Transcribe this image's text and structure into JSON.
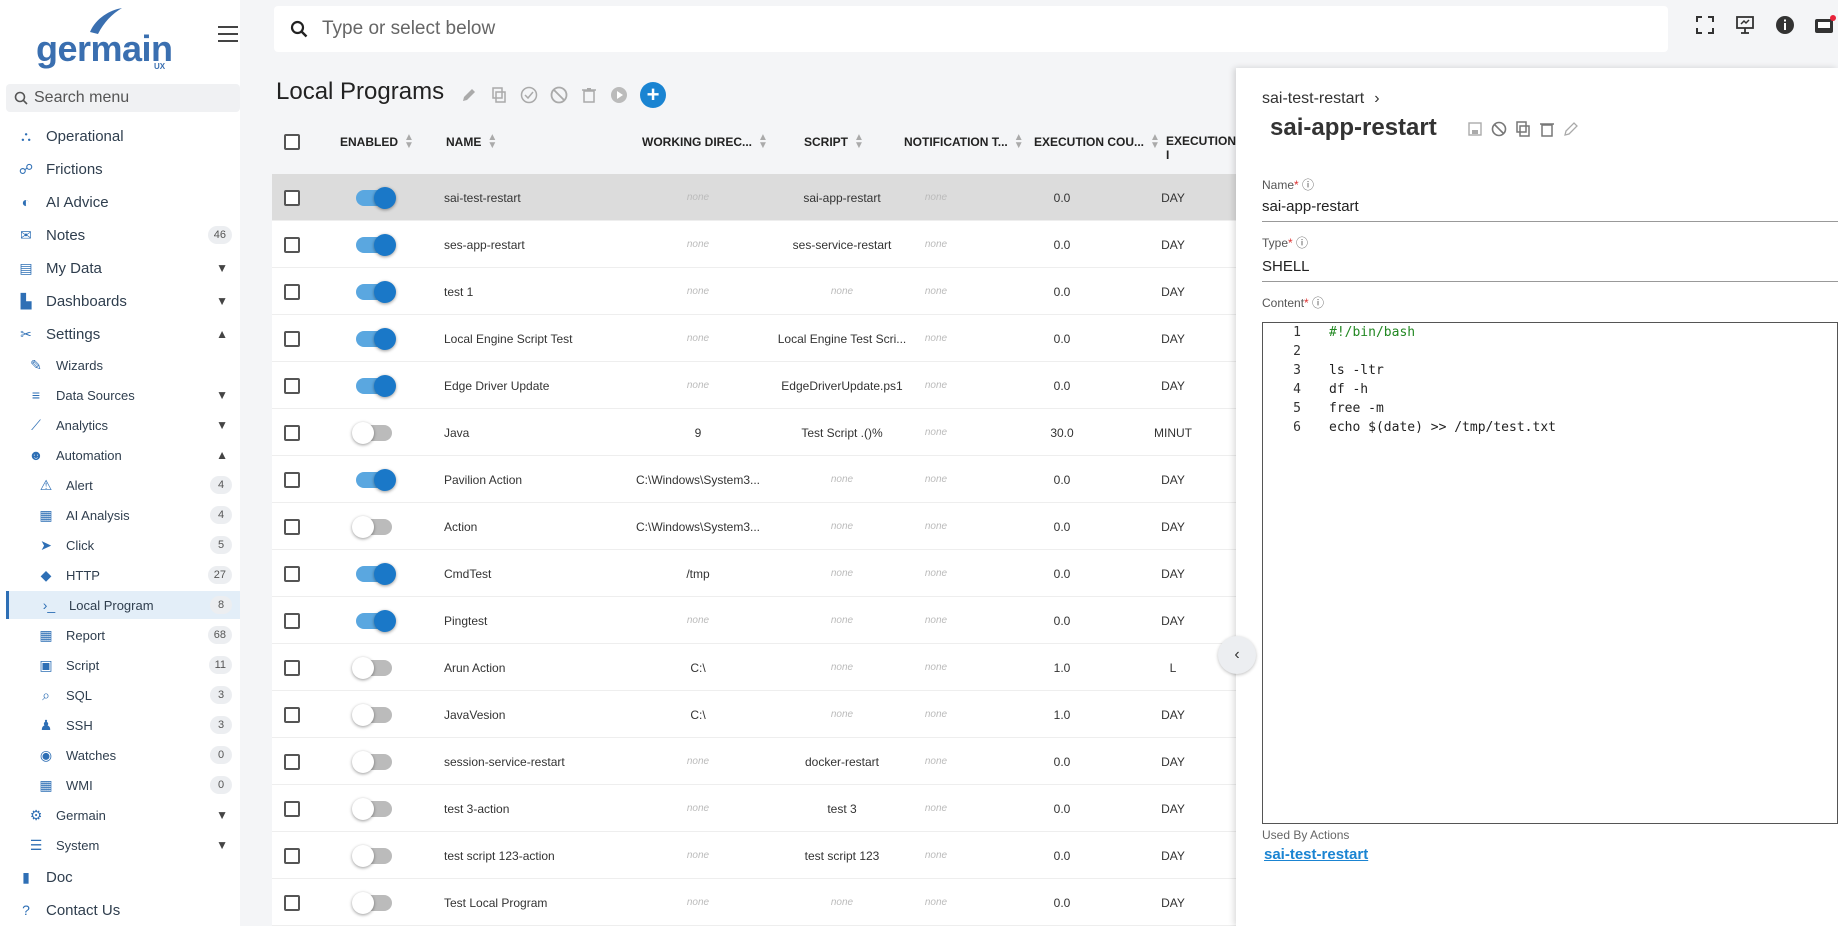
{
  "brand": {
    "name": "germain",
    "sub": "UX"
  },
  "search_menu": {
    "placeholder": "Search menu"
  },
  "topbar": {
    "search_placeholder": "Type or select below"
  },
  "nav": [
    {
      "label": "Operational",
      "icon": "sitemap-icon",
      "badge": null,
      "chev": null
    },
    {
      "label": "Frictions",
      "icon": "person-icon",
      "badge": null,
      "chev": null
    },
    {
      "label": "AI Advice",
      "icon": "brain-icon",
      "badge": null,
      "chev": null
    },
    {
      "label": "Notes",
      "icon": "comment-icon",
      "badge": "46",
      "chev": null
    },
    {
      "label": "My Data",
      "icon": "bookmark-icon",
      "badge": null,
      "chev": "down"
    },
    {
      "label": "Dashboards",
      "icon": "chart-icon",
      "badge": null,
      "chev": "down"
    },
    {
      "label": "Settings",
      "icon": "tools-icon",
      "badge": null,
      "chev": "up"
    },
    {
      "label": "Wizards",
      "icon": "wand-icon",
      "badge": null,
      "chev": null,
      "level": 1
    },
    {
      "label": "Data Sources",
      "icon": "database-icon",
      "badge": null,
      "chev": "down",
      "level": 1
    },
    {
      "label": "Analytics",
      "icon": "line-chart-icon",
      "badge": null,
      "chev": "down",
      "level": 1
    },
    {
      "label": "Automation",
      "icon": "robot-icon",
      "badge": null,
      "chev": "up",
      "level": 1
    },
    {
      "label": "Alert",
      "icon": "alert-icon",
      "badge": "4",
      "chev": null,
      "level": 2
    },
    {
      "label": "AI Analysis",
      "icon": "file-icon",
      "badge": "4",
      "chev": null,
      "level": 2
    },
    {
      "label": "Click",
      "icon": "cursor-icon",
      "badge": "5",
      "chev": null,
      "level": 2
    },
    {
      "label": "HTTP",
      "icon": "http-icon",
      "badge": "27",
      "chev": null,
      "level": 2
    },
    {
      "label": "Local Program",
      "icon": "terminal-icon",
      "badge": "8",
      "chev": null,
      "level": 2,
      "active": true
    },
    {
      "label": "Report",
      "icon": "report-icon",
      "badge": "68",
      "chev": null,
      "level": 2
    },
    {
      "label": "Script",
      "icon": "script-icon",
      "badge": "11",
      "chev": null,
      "level": 2
    },
    {
      "label": "SQL",
      "icon": "search-icon",
      "badge": "3",
      "chev": null,
      "level": 2
    },
    {
      "label": "SSH",
      "icon": "linux-icon",
      "badge": "3",
      "chev": null,
      "level": 2
    },
    {
      "label": "Watches",
      "icon": "eye-icon",
      "badge": "0",
      "chev": null,
      "level": 2
    },
    {
      "label": "WMI",
      "icon": "windows-icon",
      "badge": "0",
      "chev": null,
      "level": 2
    },
    {
      "label": "Germain",
      "icon": "gears-icon",
      "badge": null,
      "chev": "down",
      "level": 1
    },
    {
      "label": "System",
      "icon": "server-icon",
      "badge": null,
      "chev": "down",
      "level": 1
    },
    {
      "label": "Doc",
      "icon": "book-icon",
      "badge": null,
      "chev": null
    },
    {
      "label": "Contact Us",
      "icon": "question-icon",
      "badge": null,
      "chev": null
    }
  ],
  "page": {
    "title": "Local Programs"
  },
  "table": {
    "columns": [
      "ENABLED",
      "NAME",
      "WORKING DIREC...",
      "SCRIPT",
      "NOTIFICATION T...",
      "EXECUTION COU...",
      "EXECUTION I"
    ],
    "rows": [
      {
        "enabled": true,
        "name": "sai-test-restart",
        "dir": "none",
        "script": "sai-app-restart",
        "notif": "none",
        "count": "0.0",
        "exec": "DAY",
        "selected": true
      },
      {
        "enabled": true,
        "name": "ses-app-restart",
        "dir": "none",
        "script": "ses-service-restart",
        "notif": "none",
        "count": "0.0",
        "exec": "DAY"
      },
      {
        "enabled": true,
        "name": "test 1",
        "dir": "none",
        "script": "none",
        "notif": "none",
        "count": "0.0",
        "exec": "DAY"
      },
      {
        "enabled": true,
        "name": "Local Engine Script Test",
        "dir": "none",
        "script": "Local Engine Test Scri...",
        "notif": "none",
        "count": "0.0",
        "exec": "DAY"
      },
      {
        "enabled": true,
        "name": "Edge Driver Update",
        "dir": "none",
        "script": "EdgeDriverUpdate.ps1",
        "notif": "none",
        "count": "0.0",
        "exec": "DAY"
      },
      {
        "enabled": false,
        "name": "Java",
        "dir": "9",
        "script": "Test Script .()%",
        "notif": "none",
        "count": "30.0",
        "exec": "MINUT"
      },
      {
        "enabled": true,
        "name": "Pavilion Action",
        "dir": "C:\\Windows\\System3...",
        "script": "none",
        "notif": "none",
        "count": "0.0",
        "exec": "DAY"
      },
      {
        "enabled": false,
        "name": "Action",
        "dir": "C:\\Windows\\System3...",
        "script": "none",
        "notif": "none",
        "count": "0.0",
        "exec": "DAY"
      },
      {
        "enabled": true,
        "name": "CmdTest",
        "dir": "/tmp",
        "script": "none",
        "notif": "none",
        "count": "0.0",
        "exec": "DAY"
      },
      {
        "enabled": true,
        "name": "Pingtest",
        "dir": "none",
        "script": "none",
        "notif": "none",
        "count": "0.0",
        "exec": "DAY"
      },
      {
        "enabled": false,
        "name": "Arun Action",
        "dir": "C:\\",
        "script": "none",
        "notif": "none",
        "count": "1.0",
        "exec": "L"
      },
      {
        "enabled": false,
        "name": "JavaVesion",
        "dir": "C:\\",
        "script": "none",
        "notif": "none",
        "count": "1.0",
        "exec": "DAY"
      },
      {
        "enabled": false,
        "name": "session-service-restart",
        "dir": "none",
        "script": "docker-restart",
        "notif": "none",
        "count": "0.0",
        "exec": "DAY"
      },
      {
        "enabled": false,
        "name": "test 3-action",
        "dir": "none",
        "script": "test 3",
        "notif": "none",
        "count": "0.0",
        "exec": "DAY"
      },
      {
        "enabled": false,
        "name": "test script 123-action",
        "dir": "none",
        "script": "test script 123",
        "notif": "none",
        "count": "0.0",
        "exec": "DAY"
      },
      {
        "enabled": false,
        "name": "Test Local Program",
        "dir": "none",
        "script": "none",
        "notif": "none",
        "count": "0.0",
        "exec": "DAY"
      }
    ]
  },
  "panel": {
    "breadcrumb": "sai-test-restart",
    "title": "sai-app-restart",
    "name_label": "Name",
    "name_value": "sai-app-restart",
    "type_label": "Type",
    "type_value": "SHELL",
    "content_label": "Content",
    "code": [
      {
        "n": "1",
        "t": "#!/bin/bash"
      },
      {
        "n": "2",
        "t": ""
      },
      {
        "n": "3",
        "t": "ls -ltr"
      },
      {
        "n": "4",
        "t": "df -h"
      },
      {
        "n": "5",
        "t": "free -m"
      },
      {
        "n": "6",
        "t": "echo $(date) >> /tmp/test.txt"
      }
    ],
    "used_by_label": "Used By Actions",
    "used_by_link": "sai-test-restart"
  },
  "colors": {
    "accent": "#1a84d2",
    "brand": "#3a6fb0"
  }
}
